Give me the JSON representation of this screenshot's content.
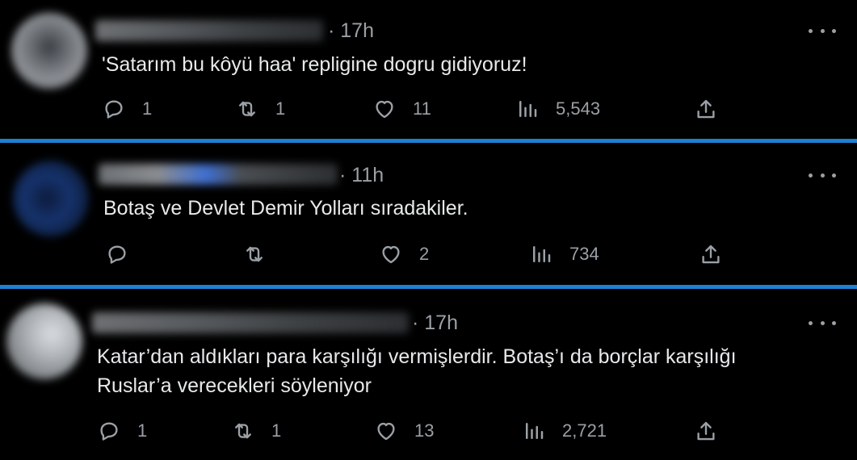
{
  "tweets": [
    {
      "time": "· 17h",
      "text_lines": [
        "'Satarım bu kôyü haa' repligine dogru gidiyoruz!"
      ],
      "replies": "1",
      "retweets": "1",
      "likes": "11",
      "views": "5,543"
    },
    {
      "time": "· 11h",
      "text_lines": [
        "Botaş ve Devlet Demir Yolları sıradakiler."
      ],
      "replies": "",
      "retweets": "",
      "likes": "2",
      "views": "734"
    },
    {
      "time": "· 17h",
      "text_lines": [
        "Katar’dan aldıkları para karşılığı vermişlerdir. Botaş’ı da borçlar karşılığı",
        "Ruslar’a verecekleri söyleniyor"
      ],
      "replies": "1",
      "retweets": "1",
      "likes": "13",
      "views": "2,721"
    }
  ],
  "icons": {
    "reply": "reply-icon",
    "retweet": "retweet-icon",
    "like": "heart-icon",
    "views": "views-chart-icon",
    "share": "share-icon",
    "more": "more-dots-icon"
  },
  "colors": {
    "background": "#000000",
    "separator": "#1d80d2",
    "text": "#e7e9ea",
    "muted": "#9aa0a6"
  }
}
